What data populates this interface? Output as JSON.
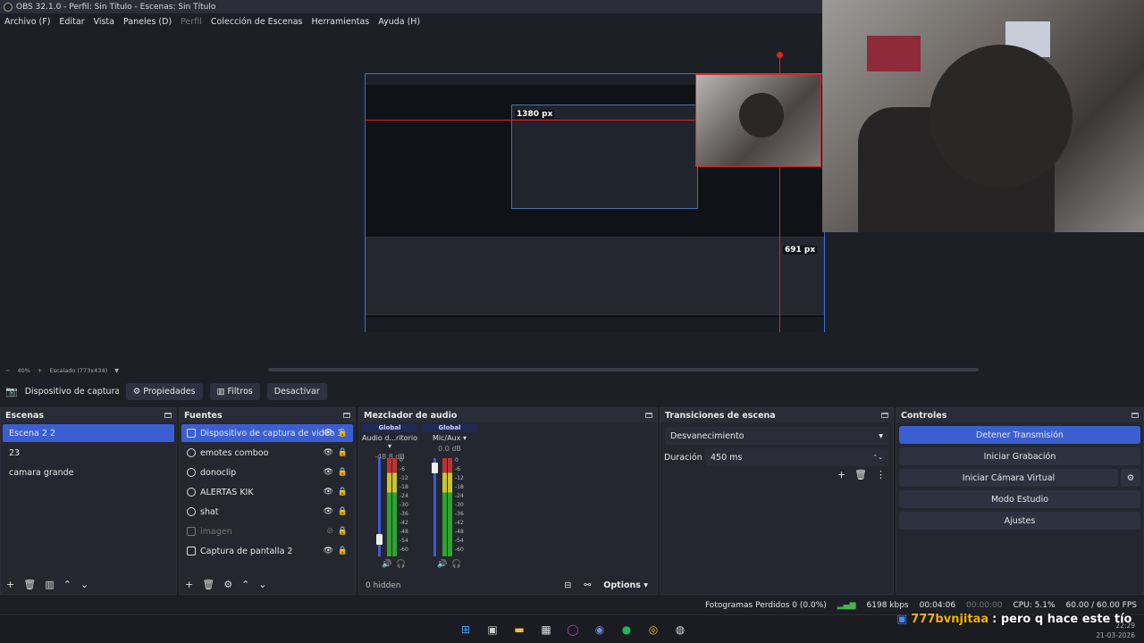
{
  "window": {
    "title": "OBS 32.1.0 - Perfil: Sin Título - Escenas: Sin Título"
  },
  "menu": [
    {
      "label": "Archivo (F)",
      "dim": false
    },
    {
      "label": "Editar",
      "dim": false
    },
    {
      "label": "Vista",
      "dim": false
    },
    {
      "label": "Paneles (D)",
      "dim": false
    },
    {
      "label": "Perfil",
      "dim": true
    },
    {
      "label": "Colección de Escenas",
      "dim": false
    },
    {
      "label": "Herramientas",
      "dim": false
    },
    {
      "label": "Ayuda (H)",
      "dim": false
    }
  ],
  "preview": {
    "label_top": "1380 px",
    "label_right": "691 px"
  },
  "scale": {
    "zoom": "40%",
    "mode": "Escalado (773x434)"
  },
  "source_bar": {
    "name": "Dispositivo de captura de v",
    "properties": "Propiedades",
    "filters": "Filtros",
    "deactivate": "Desactivar"
  },
  "scenes": {
    "title": "Escenas",
    "items": [
      "Escena 2 2",
      "23",
      "camara grande"
    ]
  },
  "sources": {
    "title": "Fuentes",
    "items": [
      {
        "label": "Dispositivo de captura de video 3",
        "icon": "camera-icon"
      },
      {
        "label": "emotes comboo",
        "icon": "browser-icon"
      },
      {
        "label": "donoclip",
        "icon": "browser-icon"
      },
      {
        "label": "ALERTAS KIK",
        "icon": "browser-icon"
      },
      {
        "label": "shat",
        "icon": "browser-icon"
      },
      {
        "label": "imagen",
        "icon": "image-icon"
      },
      {
        "label": "Captura de pantalla 2",
        "icon": "monitor-icon"
      }
    ]
  },
  "mixer": {
    "title": "Mezclador de audio",
    "channels": [
      {
        "badge": "Global",
        "name": "Audio d...ritorio",
        "db": "-48.8 dB",
        "level": 0.15
      },
      {
        "badge": "Global",
        "name": "Mic/Aux",
        "db": "0.0 dB",
        "level": 0.95
      }
    ],
    "ticks": [
      "0",
      "-6",
      "-12",
      "-18",
      "-24",
      "-30",
      "-36",
      "-42",
      "-48",
      "-54",
      "-60"
    ],
    "hidden": "0 hidden",
    "options": "Options"
  },
  "transitions": {
    "title": "Transiciones de escena",
    "selected": "Desvanecimiento",
    "duration_label": "Duración",
    "duration_value": "450 ms"
  },
  "controls": {
    "title": "Controles",
    "stop_stream": "Detener Transmisión",
    "start_record": "Iniciar Grabación",
    "virtual_cam": "Iniciar Cámara Virtual",
    "studio": "Modo Estudio",
    "settings": "Ajustes"
  },
  "status": {
    "dropped": "Fotogramas Perdidos 0 (0.0%)",
    "bitrate": "6198 kbps",
    "stream_time": "00:04:06",
    "rec_time": "00:00:00",
    "cpu": "CPU: 5.1%",
    "fps": "60.00 / 60.00 FPS"
  },
  "chat": {
    "user": "777bvnjitaa",
    "message": ": pero q hace este tío"
  },
  "clock": {
    "time": "22:29",
    "date": "21-03-2026"
  },
  "colors": {
    "accent": "#3b5fd0",
    "guide_red": "#e02424",
    "bg": "#1d1f26"
  }
}
